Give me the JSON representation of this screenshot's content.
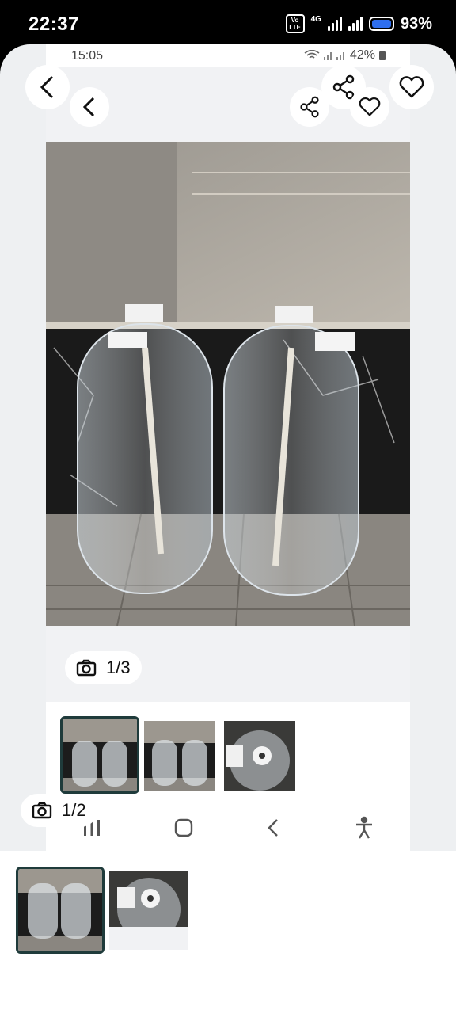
{
  "device_status": {
    "time": "22:37",
    "volte": "Vo LTE",
    "network": "4G",
    "battery": "93%"
  },
  "inner_status": {
    "time": "15:05",
    "battery": "42%"
  },
  "icons": {
    "back": "chevron-left-icon",
    "share": "share-icon",
    "favorite": "heart-icon",
    "camera": "camera-icon"
  },
  "gallery": {
    "inner_counter": "1/3",
    "outer_counter": "1/2"
  },
  "colors": {
    "selected_border": "#1f3b3b",
    "battery_fill": "#2f6ff0",
    "background": "#eef0f2"
  }
}
